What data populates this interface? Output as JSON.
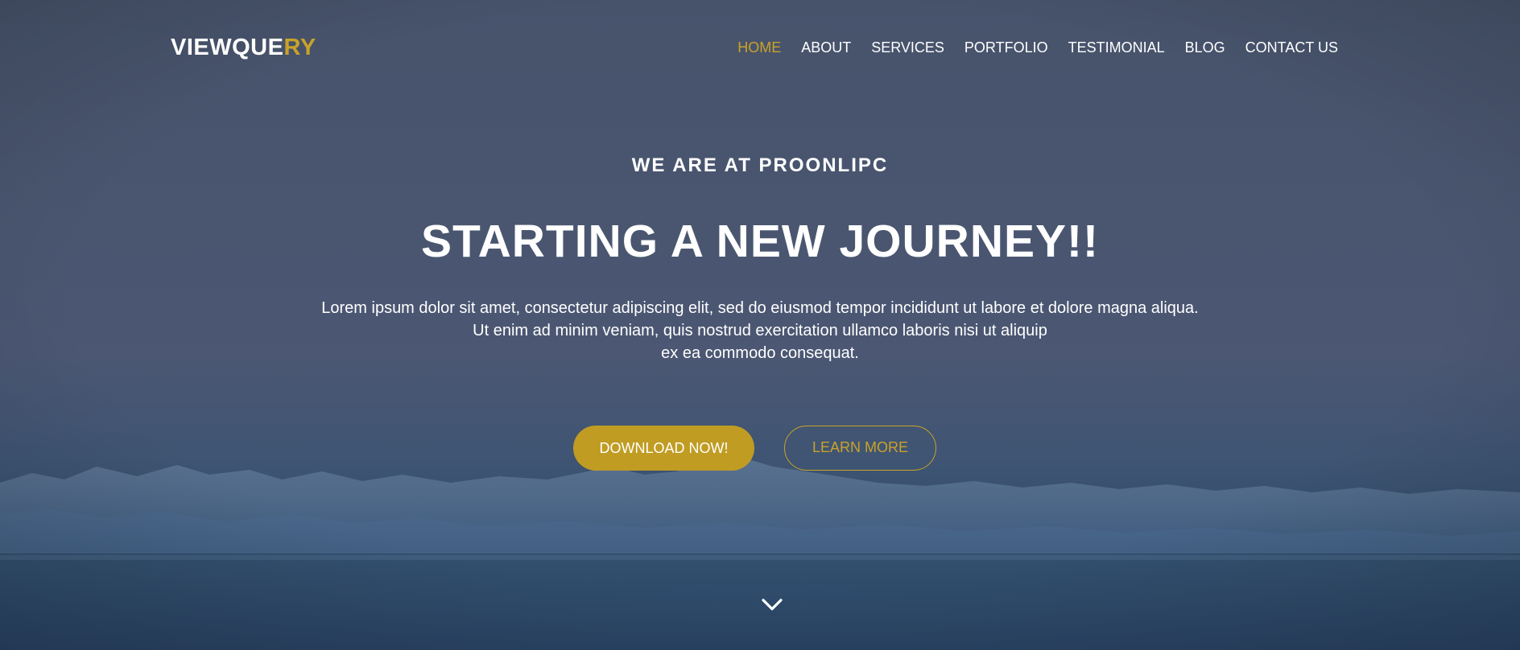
{
  "brand": {
    "logo_main": "VIEWQUE",
    "logo_accent": "RY",
    "accent_color": "#c9a227"
  },
  "nav": {
    "items": [
      {
        "label": "HOME",
        "active": true
      },
      {
        "label": "ABOUT",
        "active": false
      },
      {
        "label": "SERVICES",
        "active": false
      },
      {
        "label": "PORTFOLIO",
        "active": false
      },
      {
        "label": "TESTIMONIAL",
        "active": false
      },
      {
        "label": "BLOG",
        "active": false
      },
      {
        "label": "CONTACT US",
        "active": false
      }
    ]
  },
  "hero": {
    "subtitle": "WE ARE AT PROONLIPC",
    "title": "STARTING A NEW JOURNEY!!",
    "description_lines": [
      "Lorem ipsum dolor sit amet, consectetur adipiscing elit, sed do eiusmod tempor incididunt ut labore et dolore magna aliqua.",
      "Ut enim ad minim veniam, quis nostrud exercitation ullamco laboris nisi ut aliquip",
      "ex ea commodo consequat."
    ],
    "primary_button": "DOWNLOAD NOW!",
    "secondary_button": "LEARN MORE",
    "scroll_icon": "chevron-down-icon"
  }
}
